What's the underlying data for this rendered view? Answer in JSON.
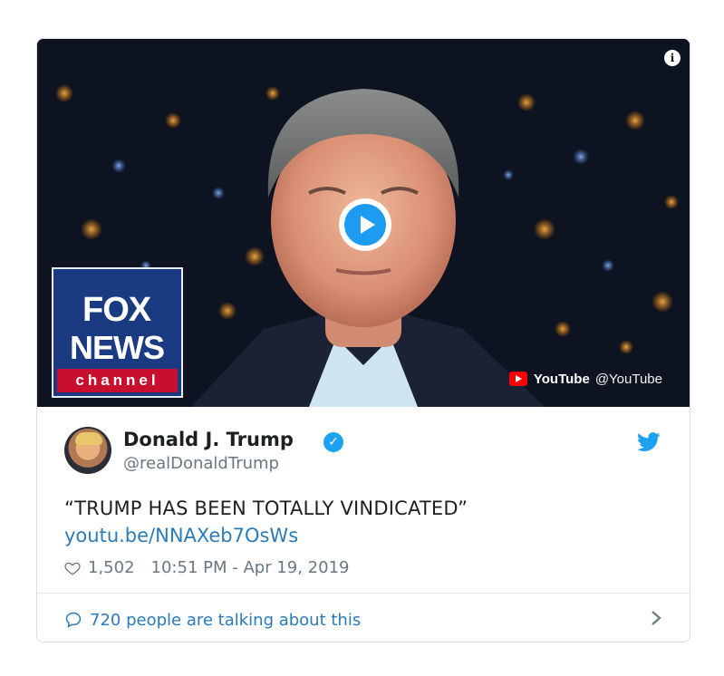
{
  "media": {
    "info_icon": "info-icon",
    "play_icon": "play-icon",
    "logo": {
      "line1": "FOX",
      "line2": "NEWS",
      "line3": "channel"
    },
    "youtube": {
      "icon": "youtube-icon",
      "name": "YouTube",
      "handle": "@YouTube"
    }
  },
  "tweet": {
    "author_name": "Donald J. Trump",
    "verified_icon": "verified-badge-icon",
    "handle": "@realDonaldTrump",
    "text": "“TRUMP HAS BEEN TOTALLY VINDICATED”",
    "link": "youtu.be/NNAXeb7OsWs",
    "likes": "1,502",
    "timestamp": "10:51 PM - Apr 19, 2019",
    "talking": "720 people are talking about this"
  },
  "colors": {
    "accent": "#2b7bb9",
    "verified": "#1da1f2",
    "play": "#1d9bf0",
    "fox_blue": "#1a3a82",
    "fox_red": "#c8102e"
  }
}
